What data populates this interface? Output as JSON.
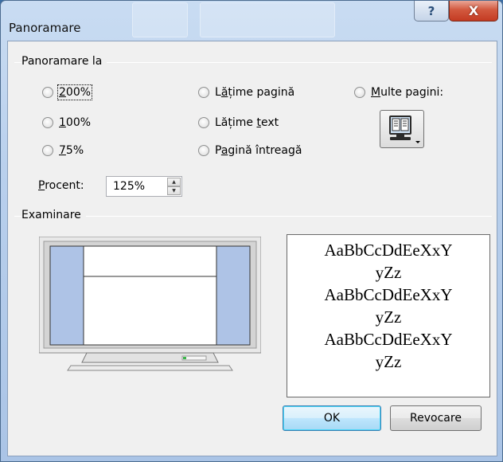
{
  "window": {
    "title": "Panoramare",
    "help_glyph": "?",
    "close_glyph": "X"
  },
  "zoom_group": {
    "title": "Panoramare la",
    "options": {
      "z200": {
        "mnemo": "2",
        "rest": "00%",
        "selected": true
      },
      "z100": {
        "mnemo": "1",
        "rest": "00%",
        "selected": false
      },
      "z75": {
        "mnemo": "7",
        "rest": "5%",
        "selected": false
      },
      "page_width": {
        "pre": "L",
        "mnemo": "ă",
        "rest": "țime pagină",
        "selected": false
      },
      "text_width": {
        "pre": "Lățime ",
        "mnemo": "t",
        "rest": "ext",
        "selected": false
      },
      "whole_page": {
        "pre": "P",
        "mnemo": "a",
        "rest": "gină întreagă",
        "selected": false
      },
      "many_pages": {
        "mnemo": "M",
        "rest": "ulte pagini:",
        "selected": false
      }
    },
    "percent": {
      "mnemo": "P",
      "rest": "rocent:",
      "value": "125%"
    }
  },
  "preview_group": {
    "title": "Examinare",
    "sample_lines": [
      "AaBbCcDdEeXxY",
      "yZz",
      "AaBbCcDdEeXxY",
      "yZz",
      "AaBbCcDdEeXxY",
      "yZz"
    ]
  },
  "buttons": {
    "ok": "OK",
    "cancel": "Revocare"
  },
  "icons": {
    "many_pages": "monitor-multiple-pages-icon",
    "help": "help-icon",
    "close": "close-icon"
  },
  "colors": {
    "preview_margin": "#aec3e6",
    "close_button": "#c43b22",
    "default_button_border": "#3c7fb1"
  }
}
